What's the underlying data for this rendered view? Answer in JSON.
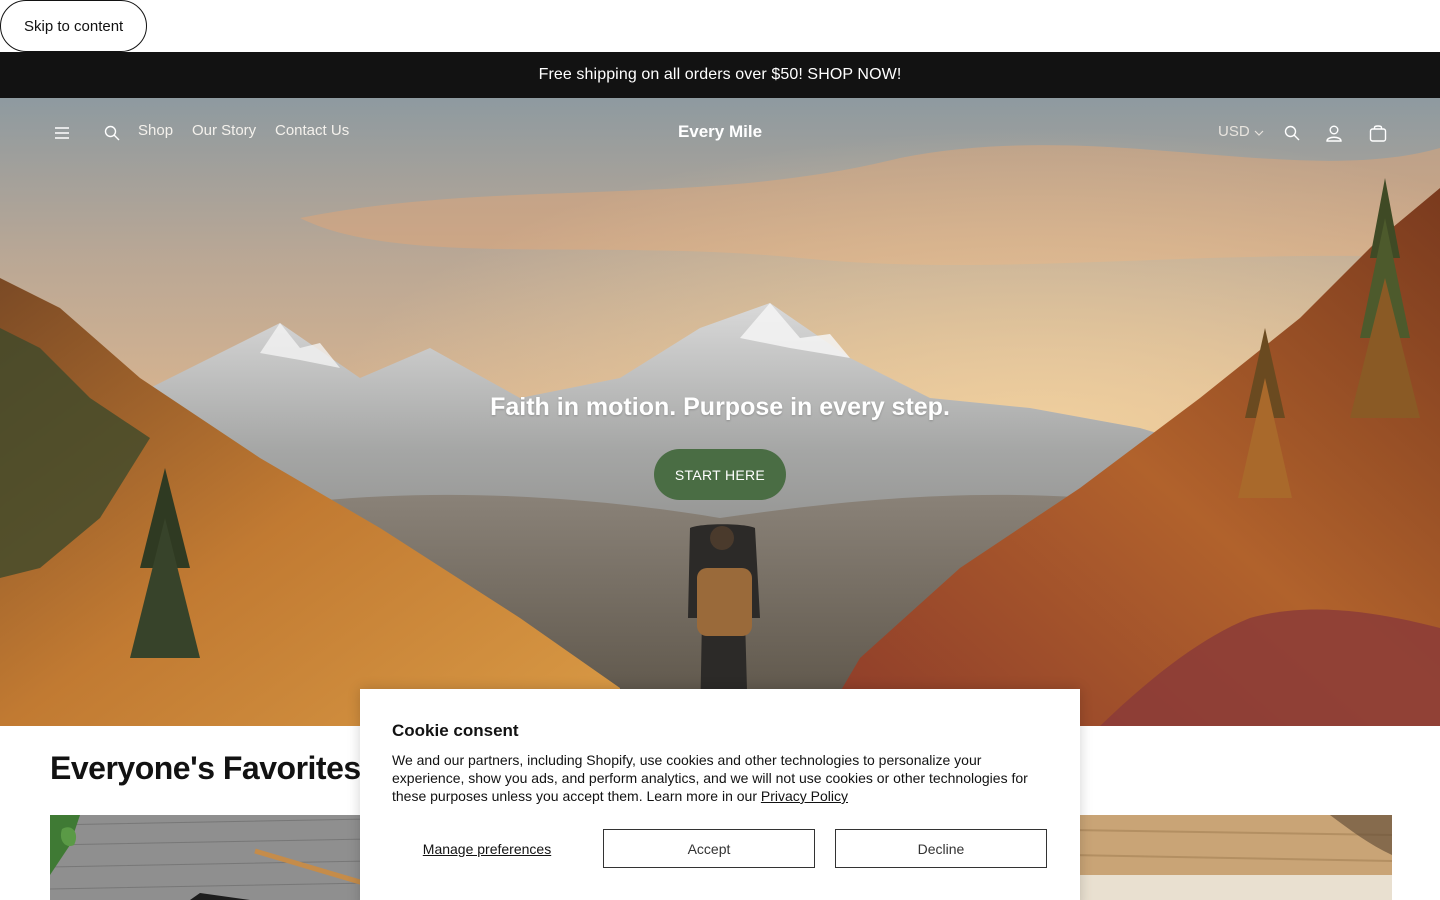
{
  "skip_link": "Skip to content",
  "announcement": "Free shipping on all orders over $50! SHOP NOW!",
  "header": {
    "brand": "Every Mile",
    "nav": [
      "Shop",
      "Our Story",
      "Contact Us"
    ],
    "currency": "USD",
    "icons": [
      "menu-icon",
      "search-icon",
      "account-icon",
      "cart-icon"
    ]
  },
  "hero": {
    "title": "Faith in motion. Purpose in every step.",
    "button": "START HERE"
  },
  "favorites": {
    "title": "Everyone's Favorites"
  },
  "cookie": {
    "title": "Cookie consent",
    "text": "We and our partners, including Shopify, use cookies and other technologies to personalize your experience, show you ads, and perform analytics, and we will not use cookies or other technologies for these purposes unless you accept them. Learn more in our ",
    "link": "Privacy Policy",
    "manage": "Manage preferences",
    "accept": "Accept",
    "decline": "Decline"
  },
  "colors": {
    "announcement_bg": "#121212",
    "hero_button": "#4a6d44"
  }
}
